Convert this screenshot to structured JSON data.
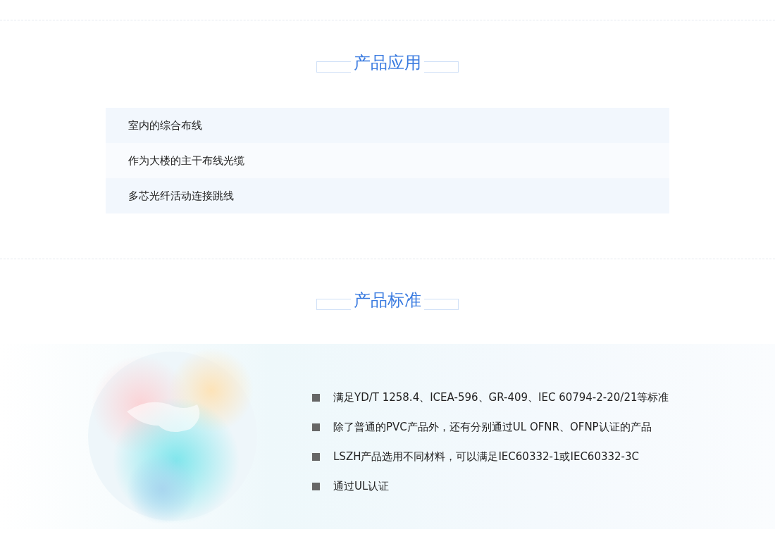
{
  "applications": {
    "title": "产品应用",
    "items": [
      "室内的综合布线",
      "作为大楼的主干布线光缆",
      "多芯光纤活动连接跳线"
    ]
  },
  "standards": {
    "title": "产品标准",
    "items": [
      "满足YD/T 1258.4、ICEA-596、GR-409、IEC 60794-2-20/21等标准",
      "除了普通的PVC产品外，还有分别通过UL OFNR、OFNP认证的产品",
      "LSZH产品选用不同材料，可以满足IEC60332-1或IEC60332-3C",
      "通过UL认证"
    ]
  }
}
